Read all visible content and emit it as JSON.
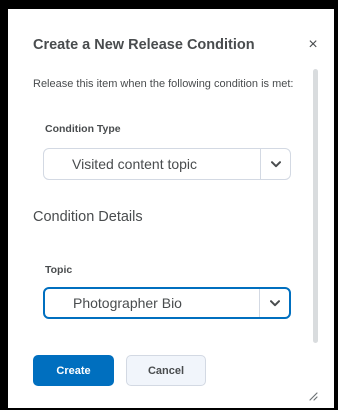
{
  "dialog": {
    "title": "Create a New Release Condition",
    "close_symbol": "×",
    "description": "Release this item when the following condition is met:"
  },
  "condition_type": {
    "label": "Condition Type",
    "selected": "Visited content topic"
  },
  "condition_details": {
    "heading": "Condition Details",
    "topic_label": "Topic",
    "topic_selected": "Photographer Bio"
  },
  "buttons": {
    "create_label": "Create",
    "cancel_label": "Cancel"
  },
  "icons": {
    "close": "close-icon",
    "dropdown": "chevron-down-icon",
    "resize": "resize-grip-icon"
  },
  "colors": {
    "primary": "#006fbf",
    "text": "#494c4e",
    "border": "#d3d9e3",
    "secondary_bg": "#f1f5fb"
  }
}
